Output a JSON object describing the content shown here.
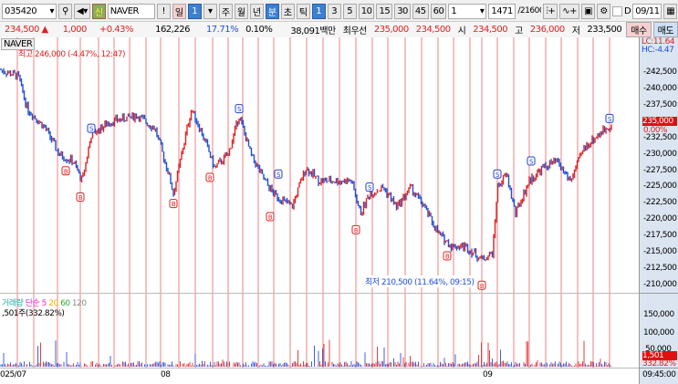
{
  "toolbar": {
    "code": "035420",
    "new_label": "신",
    "name": "NAVER",
    "alert": "!",
    "period_day": "일",
    "period_num": "1",
    "week": "주",
    "month": "월",
    "year": "년",
    "minute": "분",
    "second": "초",
    "tick": "틱",
    "intervals": [
      "1",
      "3",
      "5",
      "10",
      "15",
      "30",
      "45",
      "60"
    ],
    "count": "1",
    "bars": "1471",
    "bars_total": "/21600",
    "d_label": "D",
    "date": "09/11"
  },
  "quote": {
    "price": "234,500",
    "arrow": "▲",
    "change": "1,000",
    "change_pct": "+0.43%",
    "volume": "162,226",
    "turnover_pct": "17.71%",
    "ratio": "0.10%",
    "amount": "38,091백만",
    "best_label": "최우선",
    "ask": "235,000",
    "bid": "234,500",
    "open_label": "시",
    "open": "234,500",
    "high_label": "고",
    "high": "236,000",
    "low_label": "저",
    "low": "233,500",
    "buy": "매수",
    "sell": "매도"
  },
  "chart": {
    "title": "NAVER",
    "high_note": "최고 246,000 (-4.47%, 12:47)",
    "low_note": "최저 210,500 (11.64%, 09:15)",
    "lc": "LC:11.64",
    "hc": "HC:-4.47",
    "current_price": "235,000",
    "current_pct": "0.00%",
    "vol_legend": {
      "label": "거래량",
      "simple": "단순",
      "ma": [
        "5",
        "20",
        "60",
        "120"
      ]
    },
    "vol_note": ",501주(332.82%)",
    "vol_current": "1,501",
    "vol_pct": "332.82%",
    "vol_ticks": [
      "150,000",
      "100,000",
      "50,000"
    ],
    "x_ticks": [
      "025/07",
      "08",
      "09"
    ],
    "time": "09:45:00",
    "colors": {
      "up": "#e02020",
      "down": "#2050d0",
      "vline": "#f08080"
    }
  },
  "chart_data": {
    "type": "candlestick",
    "title": "NAVER",
    "ylim": [
      209000,
      245500
    ],
    "yticks": [
      242500,
      240000,
      237500,
      235000,
      232500,
      230000,
      227500,
      225000,
      222500,
      220000,
      217500,
      215000,
      212500,
      210000
    ],
    "x": [
      0,
      20,
      30,
      50,
      65,
      80,
      90,
      100,
      120,
      150,
      170,
      185,
      190,
      205,
      210,
      225,
      235,
      250,
      262,
      275,
      290,
      300,
      320,
      335,
      350,
      370,
      385,
      395,
      405,
      420,
      435,
      450,
      465,
      480,
      495,
      510,
      528,
      540,
      545,
      555,
      565,
      580,
      595,
      610,
      625,
      640,
      655,
      668
    ],
    "close": [
      243000,
      242000,
      237000,
      234000,
      230000,
      229000,
      226000,
      233000,
      235000,
      236000,
      234000,
      227000,
      224000,
      234000,
      237000,
      232000,
      228000,
      230000,
      236000,
      230000,
      226000,
      224000,
      222000,
      228000,
      226000,
      226000,
      226000,
      221000,
      224000,
      225000,
      222000,
      225000,
      222000,
      218000,
      216000,
      216000,
      214000,
      215000,
      225000,
      227000,
      221000,
      226000,
      228000,
      229000,
      226000,
      231000,
      233000,
      234500
    ]
  }
}
